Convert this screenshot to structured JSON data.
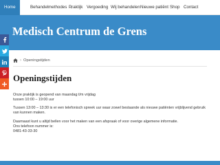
{
  "nav": {
    "items": [
      {
        "label": "Home",
        "active": true
      },
      {
        "label": "Behandelmethodes",
        "dropdown": true
      },
      {
        "label": "Praktijk"
      },
      {
        "label": "Vergoeding"
      },
      {
        "label": "Wij behandelen"
      },
      {
        "label": "Nieuwe patiënt"
      },
      {
        "label": "Shop"
      },
      {
        "label": "Contact"
      }
    ]
  },
  "hero": {
    "title": "Medisch Centrum de Grens"
  },
  "social": [
    "facebook-icon",
    "twitter-icon",
    "linkedin-icon",
    "pinterest-icon",
    "share-plus-icon"
  ],
  "breadcrumb": {
    "home_icon": "home-icon",
    "current": "Openingstijden"
  },
  "page": {
    "title": "Openingstijden",
    "lines": [
      "Onze praktijk is geopend van maandag t/m vrijdag",
      "tussen 10:00 – 19:00 uur",
      "Tussen 13:00 – 13:30 is er een telefonisch spreek uur waar zowel bestaande als nieuwe patiënten vrijblijvend gebruik van kunnen maken.",
      "Daarnaast kunt u altijd bellen voor het maken van een afspraak of voor overige algemene informatie.",
      "Ons telefoon nummer is:",
      "0481-43-33-30"
    ]
  },
  "colors": {
    "brand_blue": "#3a8bc8",
    "nav_active": "#2f7fba"
  }
}
